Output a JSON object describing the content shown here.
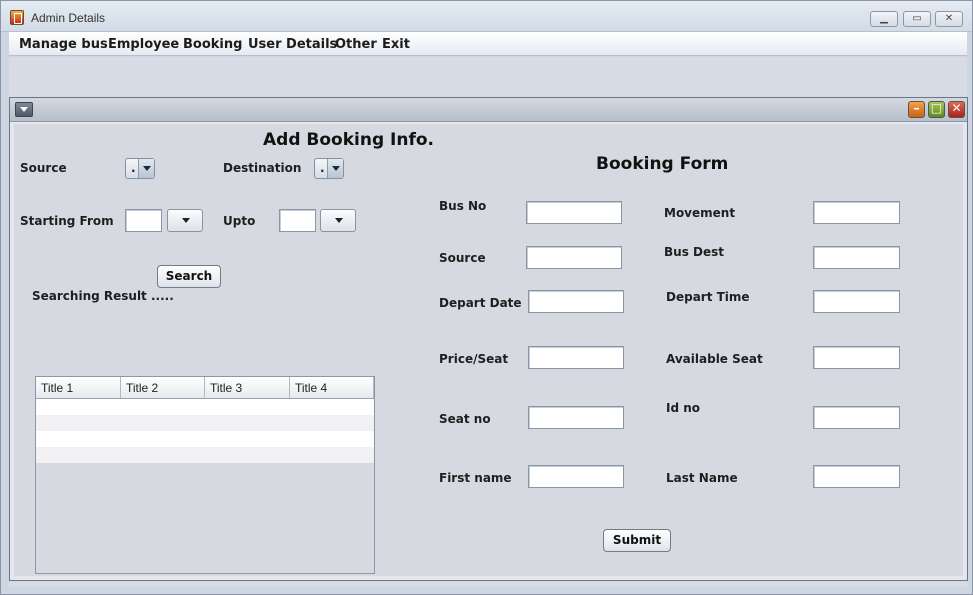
{
  "window": {
    "title": "Admin Details"
  },
  "menu": [
    "Manage bus",
    "Employee",
    "Booking",
    "User Details",
    "Other",
    "Exit"
  ],
  "search_panel": {
    "heading": "Add Booking Info.",
    "source_label": "Source",
    "source_value": ".",
    "destination_label": "Destination",
    "destination_value": ".",
    "starting_from_label": "Starting From",
    "upto_label": "Upto",
    "search_button": "Search",
    "result_label": "Searching Result .....",
    "table_columns": [
      "Title 1",
      "Title 2",
      "Title 3",
      "Title 4"
    ]
  },
  "booking_form": {
    "heading": "Booking Form",
    "fields": {
      "bus_no": "Bus No",
      "movement": "Movement",
      "source": "Source",
      "bus_dest": "Bus Dest",
      "depart_date": "Depart Date",
      "depart_time": "Depart Time",
      "price_seat": "Price/Seat",
      "available_seat": "Available Seat",
      "seat_no": "Seat no",
      "id_no": "Id no",
      "first_name": "First name",
      "last_name": "Last Name"
    },
    "submit_button": "Submit"
  }
}
